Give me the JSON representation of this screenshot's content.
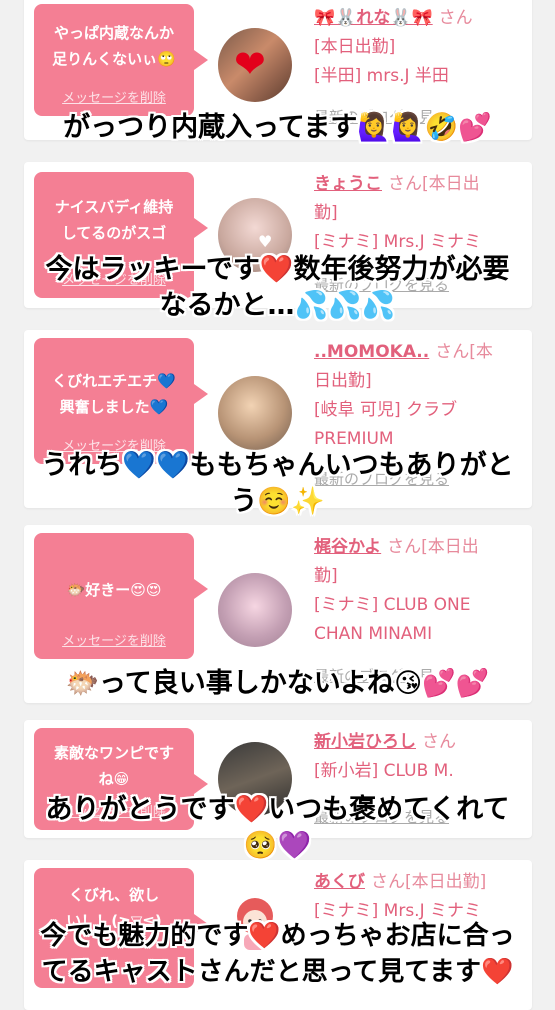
{
  "colors": {
    "accent": "#f47f94",
    "name_pink": "#e2607c",
    "background": "#f1f1f1"
  },
  "messages": [
    {
      "bubble": "やっぱ内蔵なんか\n足りんくないぃ🙄",
      "delete": "メッセージを削除",
      "name": "🎀🐰れな🐰🎀",
      "san": "さん",
      "detail_1": "[本日出勤]",
      "detail_2": "[半田] mrs.J 半田",
      "detail_3": "",
      "blog": "最新のブログを見る",
      "caption": "がっつり内蔵入ってます🙋‍♀️🙋‍♀️🤣💕"
    },
    {
      "bubble": "ナイスバディ維持\nしてるのがスゴ",
      "delete": "メッセージを削除",
      "name": "きょうこ",
      "san": "さん[本日出",
      "detail_1": "勤]",
      "detail_2": "[ミナミ] Mrs.J ミナミ",
      "detail_3": "",
      "blog": "最新のブログを見る",
      "caption": "今はラッキーです❤️数年後努力が必要\nなるかと…💦💦💦"
    },
    {
      "bubble": "くびれエチエチ💙\n興奮しました💙",
      "delete": "メッセージを削除",
      "name": "..MOMOKA..",
      "san": "さん[本",
      "detail_1": "日出勤]",
      "detail_2": "[岐阜 可児] クラブ",
      "detail_3": "PREMIUM",
      "blog": "最新のブログを見る",
      "caption": "うれち💙💙ももちゃんいつもありがと\nう☺️✨"
    },
    {
      "bubble": "🐡好きー😍😍",
      "delete": "メッセージを削除",
      "name": "梶谷かよ",
      "san": "さん[本日出",
      "detail_1": "勤]",
      "detail_2": "[ミナミ] CLUB ONE",
      "detail_3": "CHAN MINAMI",
      "blog": "最新のブログを見る",
      "caption": "🐡って良い事しかないよね😘💕💕"
    },
    {
      "bubble": "素敵なワンピです\nね😁",
      "delete": "メッセージを削除",
      "name": "新小岩ひろし",
      "san": "さん",
      "detail_1": "[新小岩] CLUB M.",
      "detail_2": "",
      "detail_3": "",
      "blog": "最新のブログを見る",
      "caption": "ありがとうです❤️いつも褒めてくれて\n🥺💜"
    },
    {
      "bubble": "くびれ、欲し\nい！！(≧▽≦)",
      "delete": "メッセージを削除",
      "name": "あくび",
      "san": "さん[本日出勤]",
      "detail_1": "[ミナミ] Mrs.J ミナミ",
      "detail_2": "",
      "detail_3": "",
      "blog": "",
      "caption": "今でも魅力的です❤️めっちゃお店に合っ\nてるキャストさんだと思って見てます❤️"
    }
  ]
}
